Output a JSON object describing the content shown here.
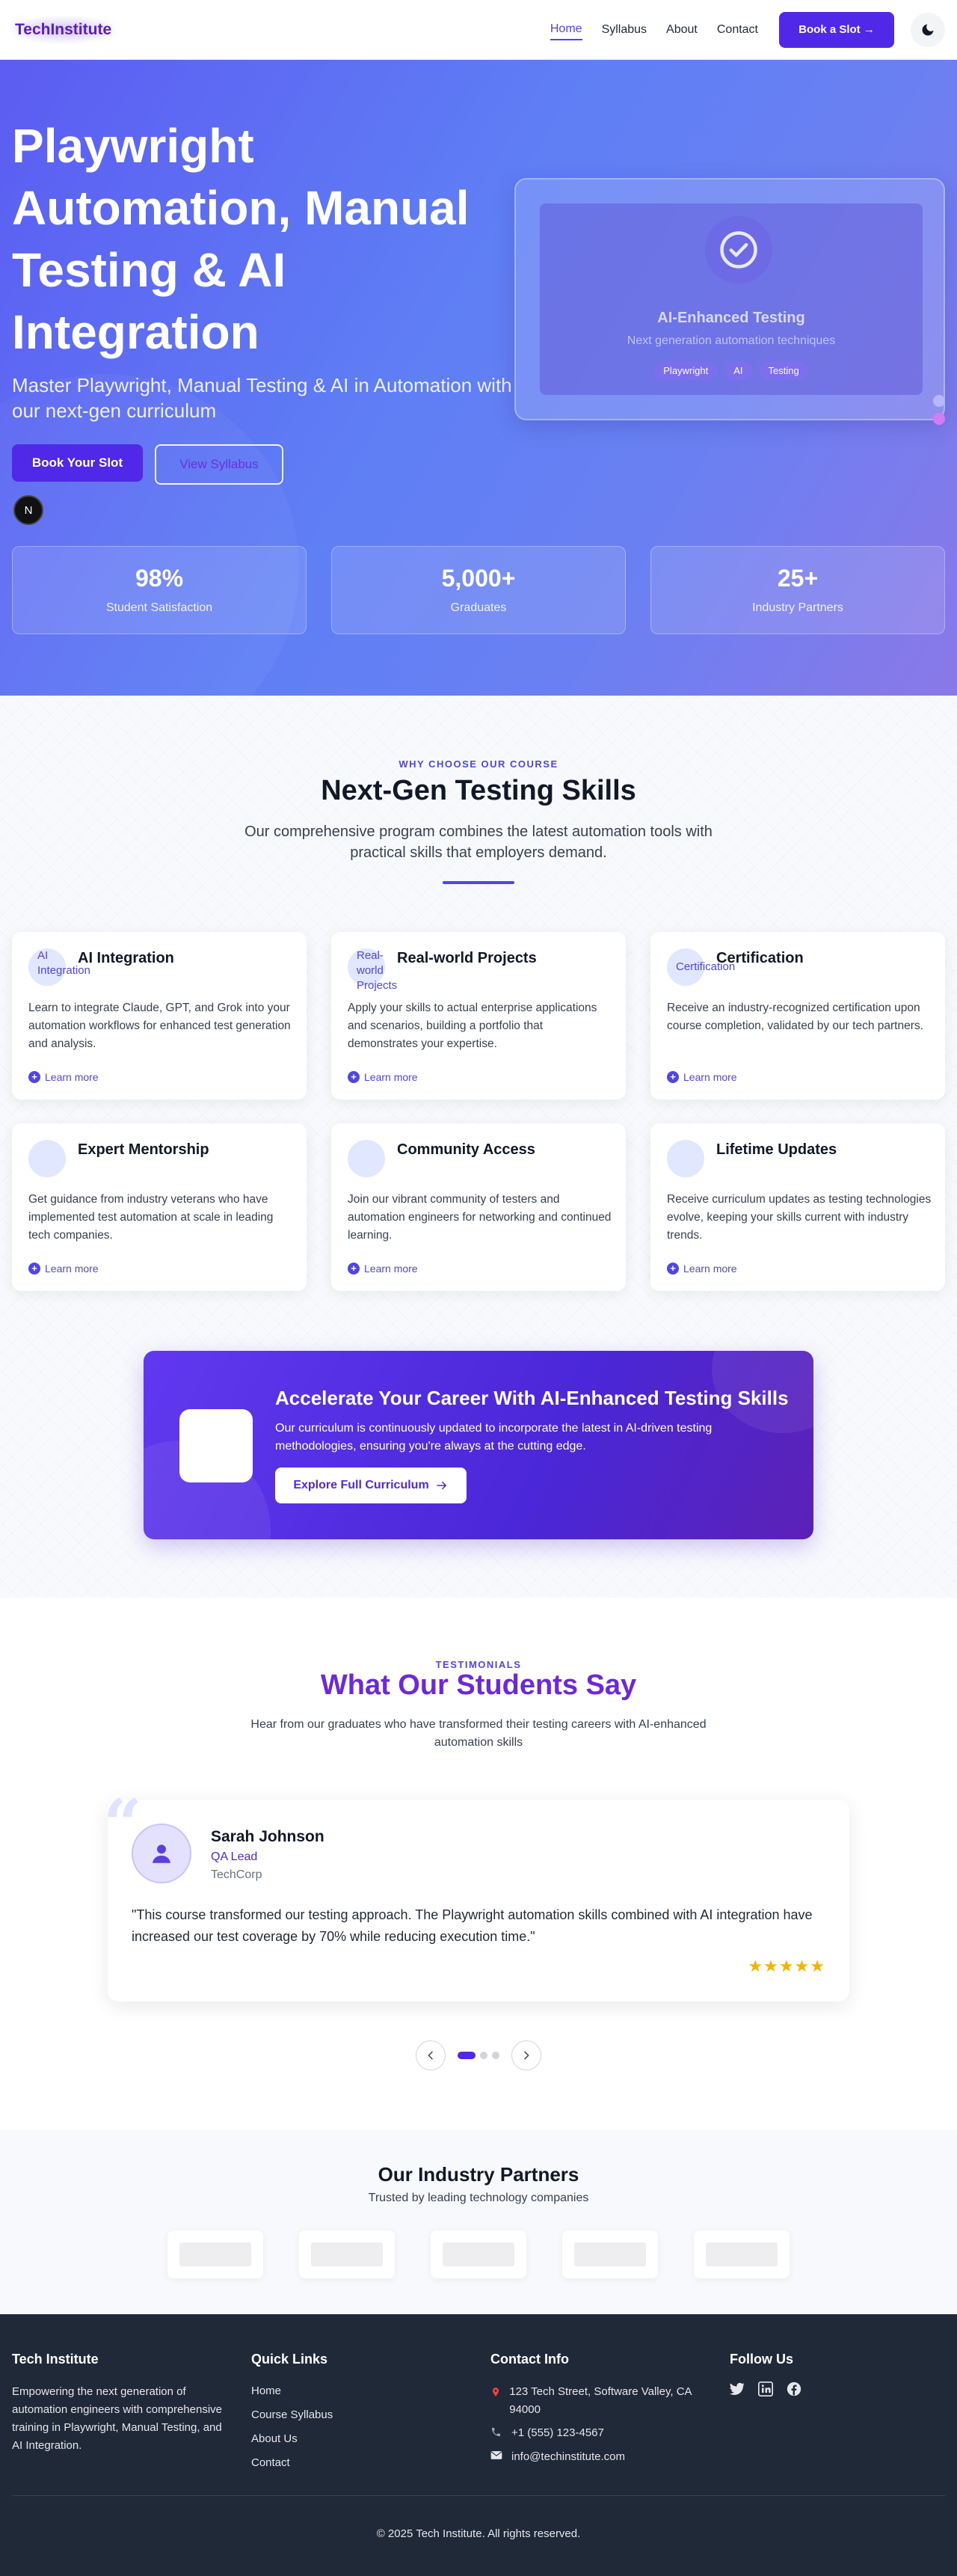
{
  "nav": {
    "logo": "TechInstitute",
    "links": [
      "Home",
      "Syllabus",
      "About",
      "Contact"
    ],
    "cta": "Book a Slot →"
  },
  "hero": {
    "title": "Playwright Automation, Manual Testing & AI Integration",
    "subtitle": "Master Playwright, Manual Testing & AI in Automation with our next-gen curriculum",
    "primary_button": "Book Your Slot",
    "secondary_button": "View Syllabus",
    "badge": "N",
    "card": {
      "title": "AI-Enhanced Testing",
      "subtitle": "Next generation automation techniques",
      "tags": [
        "Playwright",
        "AI",
        "Testing"
      ]
    },
    "stats": [
      {
        "value": "98%",
        "label": "Student Satisfaction"
      },
      {
        "value": "5,000+",
        "label": "Graduates"
      },
      {
        "value": "25+",
        "label": "Industry Partners"
      }
    ]
  },
  "features": {
    "eyebrow": "WHY CHOOSE OUR COURSE",
    "title": "Next-Gen Testing Skills",
    "subtitle": "Our comprehensive program combines the latest automation tools with practical skills that employers demand.",
    "cards": [
      {
        "icon": "AI Integration",
        "title": "AI Integration",
        "desc": "Learn to integrate Claude, GPT, and Grok into your automation workflows for enhanced test generation and analysis.",
        "link": "Learn more"
      },
      {
        "icon": "Real-world Projects",
        "title": "Real-world Projects",
        "desc": "Apply your skills to actual enterprise applications and scenarios, building a portfolio that demonstrates your expertise.",
        "link": "Learn more"
      },
      {
        "icon": "Certification",
        "title": "Certification",
        "desc": "Receive an industry-recognized certification upon course completion, validated by our tech partners.",
        "link": "Learn more"
      },
      {
        "icon": "",
        "title": "Expert Mentorship",
        "desc": "Get guidance from industry veterans who have implemented test automation at scale in leading tech companies.",
        "link": "Learn more"
      },
      {
        "icon": "",
        "title": "Community Access",
        "desc": "Join our vibrant community of testers and automation engineers for networking and continued learning.",
        "link": "Learn more"
      },
      {
        "icon": "",
        "title": "Lifetime Updates",
        "desc": "Receive curriculum updates as testing technologies evolve, keeping your skills current with industry trends.",
        "link": "Learn more"
      }
    ],
    "cta": {
      "title": "Accelerate Your Career With AI-Enhanced Testing Skills",
      "text": "Our curriculum is continuously updated to incorporate the latest in AI-driven testing methodologies, ensuring you're always at the cutting edge.",
      "button": "Explore Full Curriculum"
    }
  },
  "testimonials": {
    "eyebrow": "TESTIMONIALS",
    "title": "What Our Students Say",
    "subtitle": "Hear from our graduates who have transformed their testing careers with AI-enhanced automation skills",
    "item": {
      "name": "Sarah Johnson",
      "role": "QA Lead",
      "company": "TechCorp",
      "quote": "\"This course transformed our testing approach. The Playwright automation skills combined with AI integration have increased our test coverage by 70% while reducing execution time.\"",
      "stars": "★★★★★"
    }
  },
  "partners": {
    "title": "Our Industry Partners",
    "subtitle": "Trusted by leading technology companies"
  },
  "footer": {
    "brand": "Tech Institute",
    "desc": "Empowering the next generation of automation engineers with comprehensive training in Playwright, Manual Testing, and AI Integration.",
    "quick_links_title": "Quick Links",
    "quick_links": [
      "Home",
      "Course Syllabus",
      "About Us",
      "Contact"
    ],
    "contact_title": "Contact Info",
    "address": "123 Tech Street, Software Valley, CA 94000",
    "phone": "+1 (555) 123-4567",
    "email": "info@techinstitute.com",
    "follow_title": "Follow Us",
    "copyright": "© 2025 Tech Institute. All rights reserved."
  },
  "colors": {
    "accent": "#4f28e8",
    "brand_purple": "#6d28d9",
    "footer_bg": "#1f2937",
    "star": "#f5b400"
  },
  "icons": [
    "moon-icon",
    "check-circle-icon",
    "plus-circle-icon",
    "user-icon",
    "quote-icon",
    "chevron-left-icon",
    "chevron-right-icon",
    "arrow-right-icon",
    "map-pin-icon",
    "phone-icon",
    "mail-icon",
    "twitter-icon",
    "linkedin-icon",
    "facebook-icon"
  ]
}
